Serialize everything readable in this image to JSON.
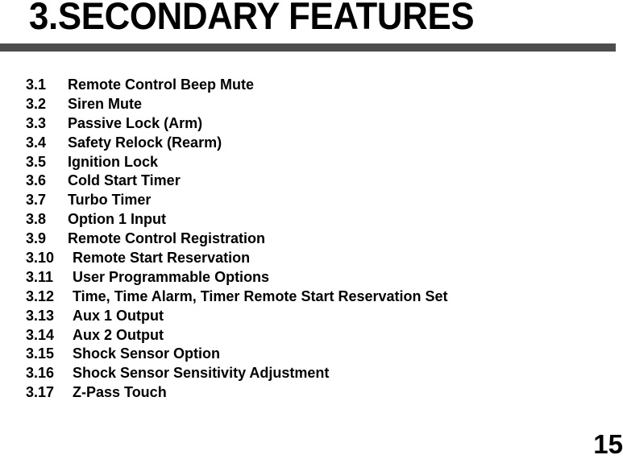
{
  "document": {
    "section_title": "3.SECONDARY FEATURES",
    "page_number": "15",
    "rule_color": "#4d4d4d"
  },
  "toc": {
    "items": [
      {
        "number": "3.1",
        "label": "Remote Control Beep Mute"
      },
      {
        "number": "3.2",
        "label": "Siren Mute"
      },
      {
        "number": "3.3",
        "label": "Passive Lock (Arm)"
      },
      {
        "number": "3.4",
        "label": "Safety Relock (Rearm)"
      },
      {
        "number": "3.5",
        "label": "Ignition Lock"
      },
      {
        "number": "3.6",
        "label": "Cold Start Timer"
      },
      {
        "number": "3.7",
        "label": "Turbo Timer"
      },
      {
        "number": "3.8",
        "label": "Option 1 Input"
      },
      {
        "number": "3.9",
        "label": "Remote Control Registration"
      },
      {
        "number": "3.10",
        "label": "Remote Start Reservation"
      },
      {
        "number": "3.11",
        "label": "User Programmable Options"
      },
      {
        "number": "3.12",
        "label": "Time, Time Alarm, Timer Remote Start Reservation Set"
      },
      {
        "number": "3.13",
        "label": "Aux 1 Output"
      },
      {
        "number": "3.14",
        "label": "Aux 2 Output"
      },
      {
        "number": "3.15",
        "label": "Shock Sensor Option"
      },
      {
        "number": "3.16",
        "label": "Shock Sensor Sensitivity Adjustment"
      },
      {
        "number": "3.17",
        "label": "Z-Pass Touch"
      }
    ]
  }
}
